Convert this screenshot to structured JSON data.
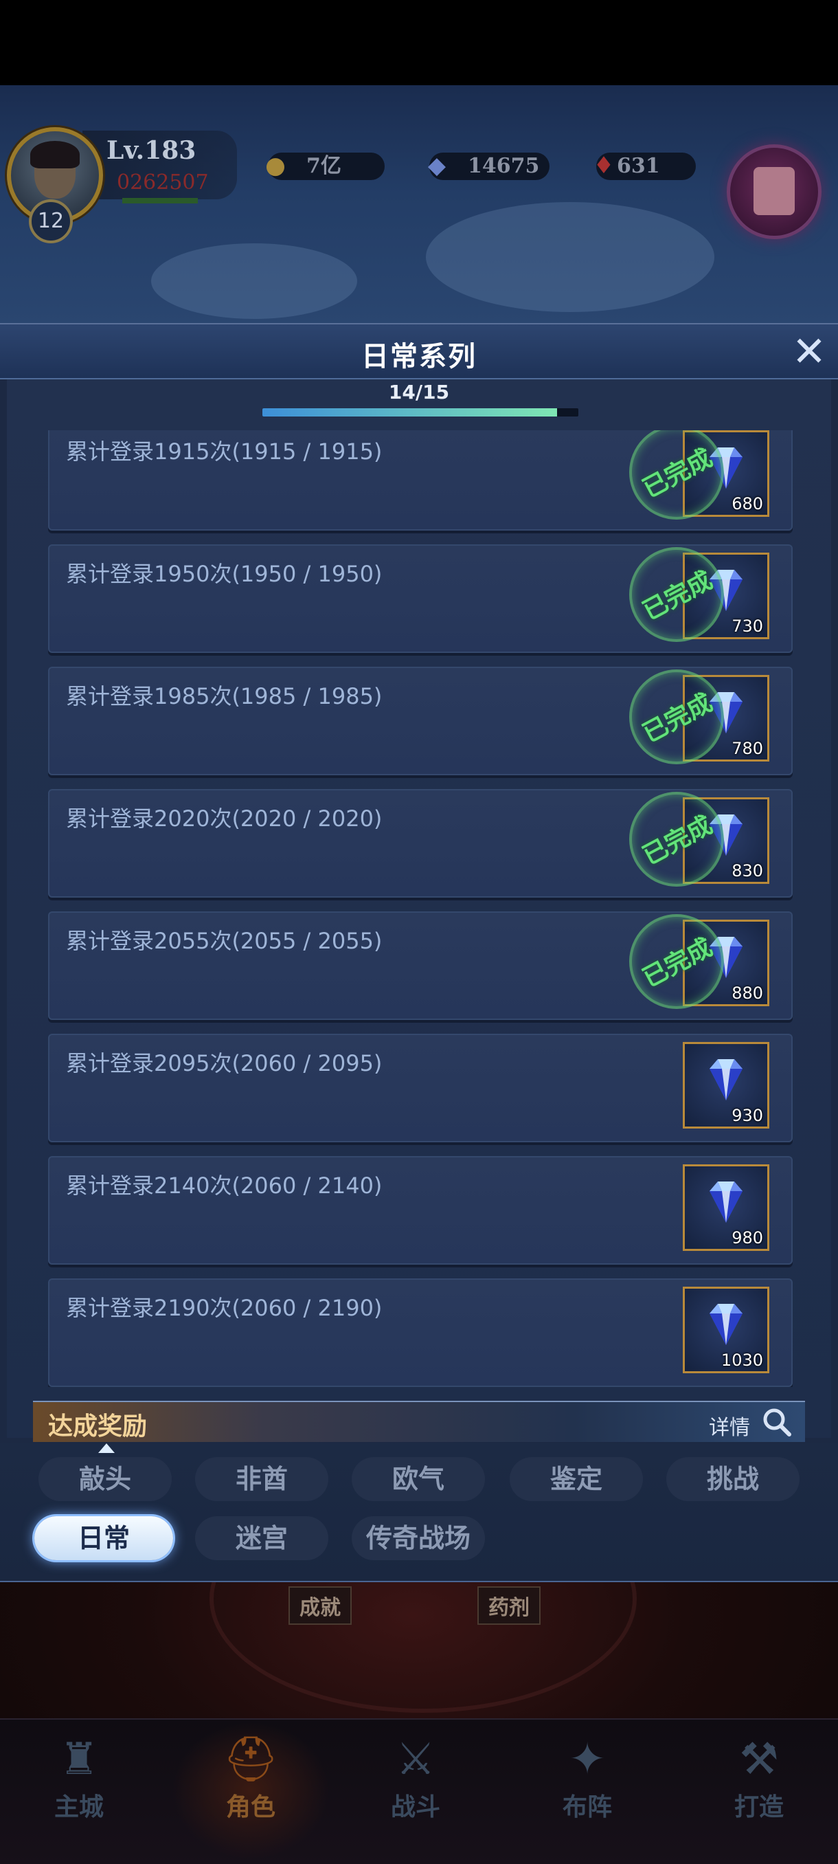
{
  "hud": {
    "level": "Lv.183",
    "power": "0262507",
    "vip": "12",
    "gold": "7亿",
    "gems": "14675",
    "ruby": "631"
  },
  "modal": {
    "title": "日常系列",
    "close_icon": "close-icon",
    "progress": {
      "label": "14/15",
      "done": 14,
      "total": 15
    }
  },
  "tasks": [
    {
      "text": "累计登录1915次(1915 / 1915)",
      "reward": "680",
      "completed": true,
      "stamp": "已完成"
    },
    {
      "text": "累计登录1950次(1950 / 1950)",
      "reward": "730",
      "completed": true,
      "stamp": "已完成"
    },
    {
      "text": "累计登录1985次(1985 / 1985)",
      "reward": "780",
      "completed": true,
      "stamp": "已完成"
    },
    {
      "text": "累计登录2020次(2020 / 2020)",
      "reward": "830",
      "completed": true,
      "stamp": "已完成"
    },
    {
      "text": "累计登录2055次(2055 / 2055)",
      "reward": "880",
      "completed": true,
      "stamp": "已完成"
    },
    {
      "text": "累计登录2095次(2060 / 2095)",
      "reward": "930",
      "completed": false
    },
    {
      "text": "累计登录2140次(2060 / 2140)",
      "reward": "980",
      "completed": false
    },
    {
      "text": "累计登录2190次(2060 / 2190)",
      "reward": "1030",
      "completed": false
    }
  ],
  "reward_strip": {
    "title": "达成奖励",
    "detail": "详情"
  },
  "tabs_row1": [
    "敲头",
    "非酋",
    "欧气",
    "鉴定",
    "挑战"
  ],
  "tabs_row2": [
    "日常",
    "迷宫",
    "传奇战场"
  ],
  "active_tab": "日常",
  "scene_labels": [
    "成就",
    "药剂"
  ],
  "nav": [
    {
      "label": "主城",
      "icon": "castle-icon"
    },
    {
      "label": "角色",
      "icon": "helmet-icon",
      "active": true
    },
    {
      "label": "战斗",
      "icon": "crossed-swords-icon"
    },
    {
      "label": "布阵",
      "icon": "formation-icon"
    },
    {
      "label": "打造",
      "icon": "anvil-icon"
    }
  ],
  "colors": {
    "accent_green": "#62e37a",
    "frame_gold": "#b98a3a",
    "panel_blue": "#1c2943"
  }
}
